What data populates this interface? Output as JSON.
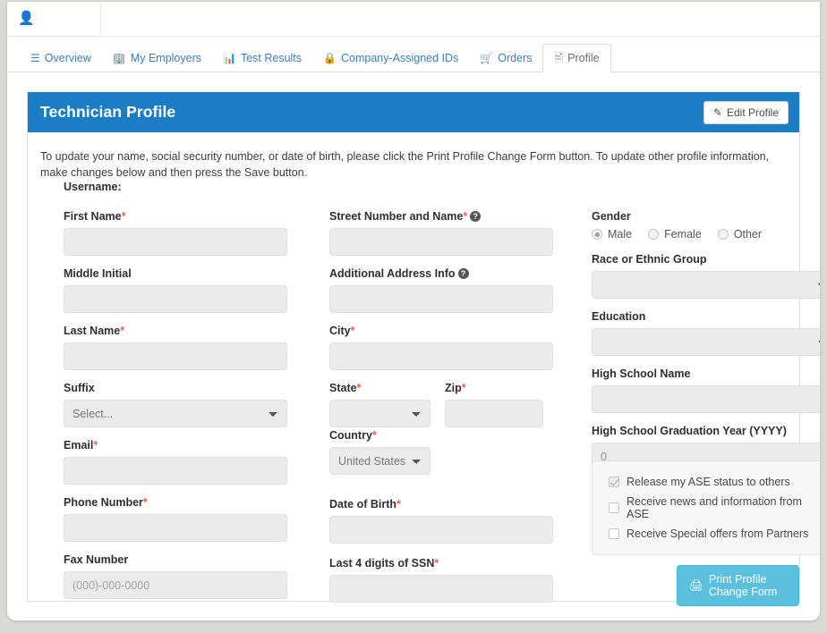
{
  "tabs": [
    {
      "label": "Overview",
      "icon": "list-icon",
      "active": false
    },
    {
      "label": "My Employers",
      "icon": "building-icon",
      "active": false
    },
    {
      "label": "Test Results",
      "icon": "bar-chart-icon",
      "active": false
    },
    {
      "label": "Company-Assigned IDs",
      "icon": "id-badge-icon",
      "active": false
    },
    {
      "label": "Orders",
      "icon": "shopping-cart-icon",
      "active": false
    },
    {
      "label": "Profile",
      "icon": "id-card-icon",
      "active": true
    }
  ],
  "card": {
    "title": "Technician Profile",
    "edit_button": "Edit Profile",
    "intro": "To update your name, social security number, or date of birth, please click the Print Profile Change Form button. To update other profile information, make changes below and then press the Save button."
  },
  "form": {
    "username_label": "Username:",
    "username_value": "",
    "left": {
      "first_name": {
        "label": "First Name",
        "required": true,
        "value": "",
        "placeholder": ""
      },
      "middle_initial": {
        "label": "Middle Initial",
        "required": false,
        "value": "",
        "placeholder": ""
      },
      "last_name": {
        "label": "Last Name",
        "required": true,
        "value": "",
        "placeholder": ""
      },
      "suffix": {
        "label": "Suffix",
        "required": false,
        "value": "Select...",
        "options": [
          "Select..."
        ]
      },
      "email": {
        "label": "Email",
        "required": true,
        "value": "",
        "placeholder": ""
      },
      "phone_number": {
        "label": "Phone Number",
        "required": true,
        "value": "",
        "placeholder": ""
      },
      "fax_number": {
        "label": "Fax Number",
        "required": false,
        "value": "",
        "placeholder": "(000)-000-0000"
      }
    },
    "middle": {
      "street": {
        "label": "Street Number and Name",
        "required": true,
        "help": true,
        "value": "",
        "placeholder": ""
      },
      "additional_address": {
        "label": "Additional Address Info",
        "required": false,
        "help": true,
        "value": "",
        "placeholder": ""
      },
      "city": {
        "label": "City",
        "required": true,
        "value": "",
        "placeholder": ""
      },
      "state": {
        "label": "State",
        "required": true,
        "value": "",
        "options": [
          ""
        ]
      },
      "zip": {
        "label": "Zip",
        "required": true,
        "value": "",
        "placeholder": ""
      },
      "country": {
        "label": "Country",
        "required": true,
        "value": "United States",
        "options": [
          "United States"
        ]
      },
      "date_of_birth": {
        "label": "Date of Birth",
        "required": true,
        "value": "",
        "placeholder": ""
      },
      "ssn_last4": {
        "label": "Last 4 digits of SSN",
        "required": true,
        "value": "",
        "placeholder": ""
      }
    },
    "right": {
      "gender": {
        "label": "Gender",
        "options": [
          {
            "label": "Male",
            "selected": true
          },
          {
            "label": "Female",
            "selected": false
          },
          {
            "label": "Other",
            "selected": false
          }
        ]
      },
      "race": {
        "label": "Race or Ethnic Group",
        "required": false,
        "value": "",
        "options": [
          ""
        ]
      },
      "education": {
        "label": "Education",
        "required": false,
        "value": "",
        "options": [
          ""
        ]
      },
      "high_school_name": {
        "label": "High School Name",
        "required": false,
        "value": "",
        "placeholder": ""
      },
      "high_school_year": {
        "label": "High School Graduation Year (YYYY)",
        "required": false,
        "value": "0",
        "placeholder": ""
      },
      "preferences": [
        {
          "label": "Release my ASE status to others",
          "checked": true
        },
        {
          "label": "Receive news and information from ASE",
          "checked": false
        },
        {
          "label": "Receive Special offers from Partners",
          "checked": false
        }
      ],
      "print_button": "Print Profile Change Form"
    }
  },
  "colors": {
    "header_blue": "#1b7ec4",
    "link_blue": "#3b7dbd",
    "print_button": "#5bc0de",
    "required_red": "#e8604c",
    "field_bg": "#ebebeb",
    "page_bg": "#d9d9d6"
  }
}
